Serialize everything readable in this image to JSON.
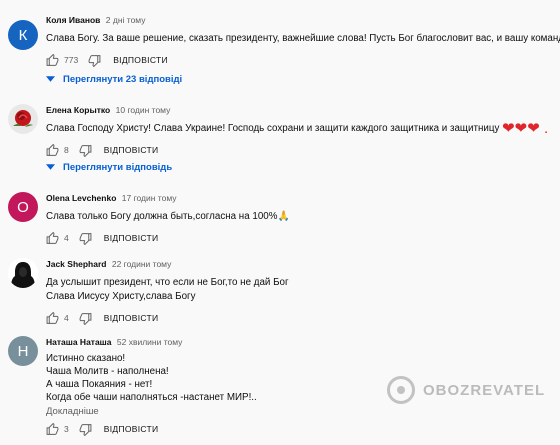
{
  "comments": [
    {
      "avatar_letter": "К",
      "avatar_color": "#1565c0",
      "author": "Коля Иванов",
      "time": "2 дні тому",
      "lines": [
        "Слава Богу. За ваше решение, сказать президенту, важнейшие слова! Пусть Бог благословит вас, и вашу команду."
      ],
      "likes": "773",
      "reply_label": "ВІДПОВІСТИ",
      "replies_label": "Переглянути 23 відповіді"
    },
    {
      "avatar_color": "#f5f5f5",
      "author": "Елена Корытко",
      "time": "10 годин тому",
      "lines": [
        "Слава Господу Христу! Слава Украине! Господь сохрани и защити каждого защитника и защитницу"
      ],
      "emoji_suffix": "❤❤❤ .",
      "likes": "8",
      "reply_label": "ВІДПОВІСТИ",
      "replies_label": "Переглянути відповідь"
    },
    {
      "avatar_letter": "O",
      "avatar_color": "#c2185b",
      "author": "Olena Levchenko",
      "time": "17 годин тому",
      "lines": [
        "Слава только Богу должна быть,согласна на 100%"
      ],
      "emoji_suffix": "🙏",
      "likes": "4",
      "reply_label": "ВІДПОВІСТИ"
    },
    {
      "avatar_color": "#ffffff",
      "author": "Jack Shephard",
      "time": "22 години тому",
      "lines": [
        "Да услышит президент, что если не Бог,то не дай Бог",
        "Слава Иисусу Христу,слава Богу"
      ],
      "likes": "4",
      "reply_label": "ВІДПОВІСТИ"
    },
    {
      "avatar_letter": "Н",
      "avatar_color": "#78909c",
      "author": "Наташа Наташа",
      "time": "52 хвилини тому",
      "lines": [
        "Истинно сказано!",
        "Чаша Молитв - наполнена!",
        "А чаша Покаяния - нет!",
        "Когда  обе чаши наполняться -настанет МИР!.."
      ],
      "more_label": "Докладніше",
      "likes": "3",
      "reply_label": "ВІДПОВІСТИ"
    }
  ],
  "watermark": "OBOZREVATEL"
}
